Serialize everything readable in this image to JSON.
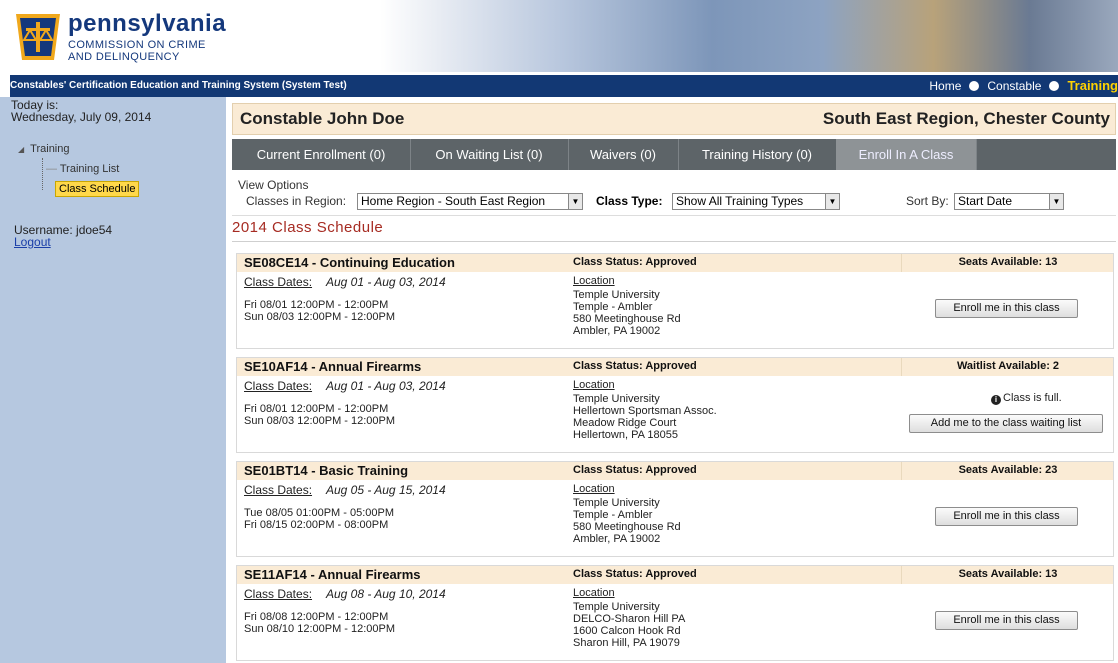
{
  "header": {
    "logo_title": "pennsylvania",
    "logo_sub1": "COMMISSION ON CRIME",
    "logo_sub2": "AND DELINQUENCY"
  },
  "navbar": {
    "system_title": "Constables' Certification Education and Training System (System Test)",
    "links": [
      "Home",
      "Constable",
      "Training"
    ]
  },
  "sidebar": {
    "today_label": "Today is:",
    "today_date": "Wednesday, July 09, 2014",
    "tree_root": "Training",
    "tree_items": [
      "Training List",
      "Class Schedule"
    ],
    "username": "Username: jdoe54",
    "logout": "Logout"
  },
  "profile": {
    "name": "Constable John Doe",
    "region": "South East Region, Chester County"
  },
  "tabs": [
    "Current Enrollment (0)",
    "On Waiting List (0)",
    "Waivers (0)",
    "Training History (0)",
    "Enroll In A Class"
  ],
  "view_options": {
    "title": "View Options",
    "region_label": "Classes in Region:",
    "region_value": "Home Region - South East Region",
    "classtype_label": "Class Type:",
    "classtype_value": "Show All Training Types",
    "sort_label": "Sort By:",
    "sort_value": "Start Date"
  },
  "schedule_title": "2014 Class Schedule",
  "classes": [
    {
      "code": "SE08CE14 - Continuing Education",
      "status": "Class Status: Approved",
      "seats": "Seats Available: 13",
      "dates_label": "Class Dates:",
      "dates": "Aug 01 - Aug 03, 2014",
      "sessions": [
        "Fri 08/01 12:00PM - 12:00PM",
        "Sun 08/03 12:00PM - 12:00PM"
      ],
      "location_label": "Location",
      "location": [
        "Temple University",
        "Temple - Ambler",
        "580 Meetinghouse Rd",
        "Ambler, PA 19002"
      ],
      "button": "Enroll me in this class"
    },
    {
      "code": "SE10AF14 - Annual Firearms",
      "status": "Class Status: Approved",
      "seats": "Waitlist Available: 2",
      "dates_label": "Class Dates:",
      "dates": "Aug 01 - Aug 03, 2014",
      "sessions": [
        "Fri 08/01 12:00PM - 12:00PM",
        "Sun 08/03 12:00PM - 12:00PM"
      ],
      "location_label": "Location",
      "location": [
        "Temple University",
        "Hellertown Sportsman Assoc.",
        "Meadow Ridge Court",
        "Hellertown, PA 18055"
      ],
      "full_text": "Class is full.",
      "button": "Add me to the class waiting list"
    },
    {
      "code": "SE01BT14 - Basic Training",
      "status": "Class Status: Approved",
      "seats": "Seats Available: 23",
      "dates_label": "Class Dates:",
      "dates": "Aug 05 - Aug 15, 2014",
      "sessions": [
        "Tue 08/05 01:00PM - 05:00PM",
        "Fri 08/15 02:00PM - 08:00PM"
      ],
      "location_label": "Location",
      "location": [
        "Temple University",
        "Temple - Ambler",
        "580 Meetinghouse Rd",
        "Ambler, PA 19002"
      ],
      "button": "Enroll me in this class"
    },
    {
      "code": "SE11AF14 - Annual Firearms",
      "status": "Class Status: Approved",
      "seats": "Seats Available: 13",
      "dates_label": "Class Dates:",
      "dates": "Aug 08 - Aug 10, 2014",
      "sessions": [
        "Fri 08/08 12:00PM - 12:00PM",
        "Sun 08/10 12:00PM - 12:00PM"
      ],
      "location_label": "Location",
      "location": [
        "Temple University",
        "DELCO-Sharon Hill PA",
        "1600 Calcon Hook Rd",
        "Sharon Hill, PA 19079"
      ],
      "button": "Enroll me in this class"
    }
  ]
}
